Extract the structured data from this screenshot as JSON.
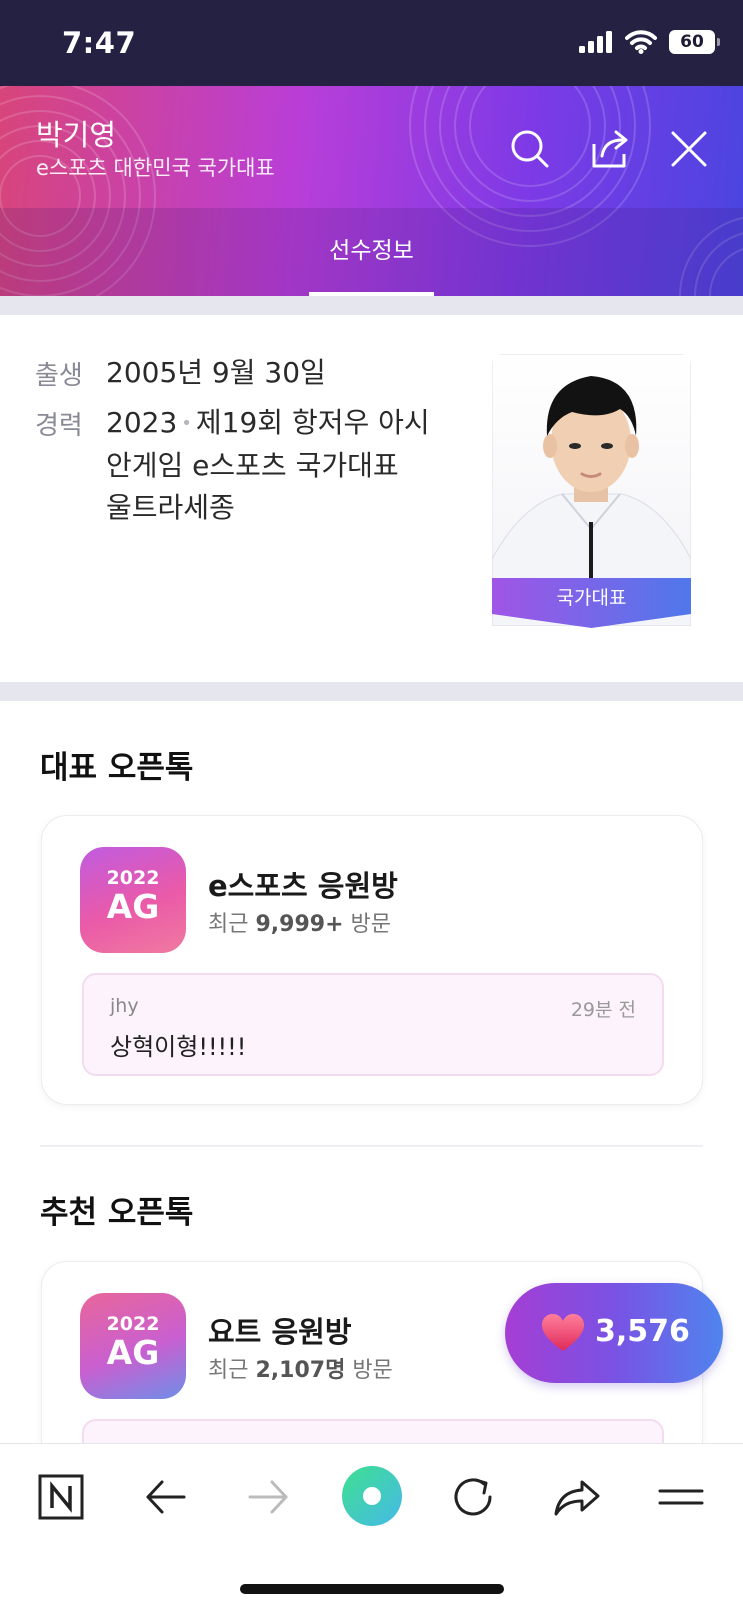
{
  "status_bar": {
    "time": "7:47",
    "battery": "60"
  },
  "header": {
    "player_name": "박기영",
    "player_subtitle": "e스포츠 대한민국 국가대표",
    "tab_label": "선수정보",
    "icons": [
      "search-icon",
      "share-icon",
      "close-icon"
    ]
  },
  "profile": {
    "birth_label": "출생",
    "birth_value": "2005년 9월 30일",
    "career_label": "경력",
    "career_year": "2023",
    "career_line1": "제19회 항저우 아시",
    "career_line2": "안게임 e스포츠 국가대표",
    "career_line3": "울트라세종",
    "photo_badge": "국가대표"
  },
  "featured": {
    "section_title": "대표 오픈톡",
    "icon_year": "2022",
    "icon_text": "AG",
    "room_name": "e스포츠 응원방",
    "visits_prefix": "최근",
    "visits_count": "9,999+",
    "visits_suffix": "방문",
    "message": {
      "user": "jhy",
      "time": "29분 전",
      "text": "상혁이형!!!!!"
    }
  },
  "recommended": {
    "section_title": "추천 오픈톡",
    "icon_year": "2022",
    "icon_text": "AG",
    "room_name": "요트 응원방",
    "visits_prefix": "최근",
    "visits_count": "2,107명",
    "visits_suffix": "방문"
  },
  "like_button": {
    "count": "3,576"
  },
  "bottom_nav": {
    "items": [
      "naver-home-icon",
      "back-arrow-icon",
      "forward-arrow-icon",
      "green-dot-icon",
      "refresh-icon",
      "share-arrow-icon",
      "menu-icon"
    ]
  },
  "colors": {
    "status_bar": "#252142",
    "header_gradient": [
      "#d8457a",
      "#b93ed8",
      "#7e3ae6",
      "#4a45e0"
    ],
    "like_gradient": [
      "#a53ed4",
      "#4f84ee"
    ]
  }
}
